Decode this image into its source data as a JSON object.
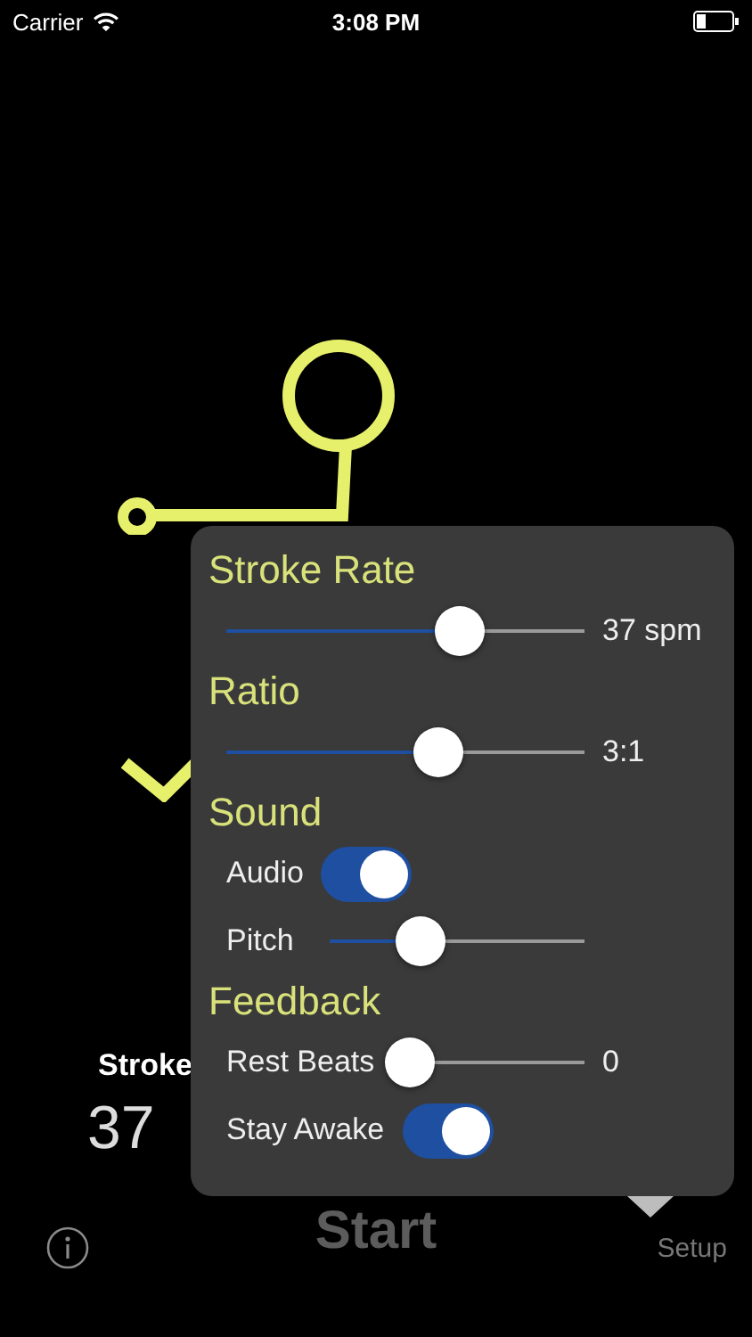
{
  "status_bar": {
    "carrier": "Carrier",
    "time": "3:08 PM"
  },
  "background": {
    "stat_label": "Stroke",
    "stat_value": "37"
  },
  "popover": {
    "sections": [
      {
        "title": "Stroke Rate",
        "rows": [
          {
            "kind": "slider",
            "level": 0.65,
            "value": "37 spm"
          }
        ]
      },
      {
        "title": "Ratio",
        "rows": [
          {
            "kind": "slider",
            "level": 0.59,
            "value": "3:1"
          }
        ]
      },
      {
        "title": "Sound",
        "rows": [
          {
            "kind": "toggle",
            "label": "Audio",
            "on": true
          },
          {
            "kind": "slider",
            "label": "Pitch",
            "level": 0.36
          }
        ]
      },
      {
        "title": "Feedback",
        "rows": [
          {
            "kind": "slider",
            "label": "Rest Beats",
            "level": 0,
            "value": "0"
          },
          {
            "kind": "toggle",
            "label": "Stay Awake",
            "on": true
          }
        ]
      }
    ]
  },
  "bottom_bar": {
    "start": "Start",
    "setup": "Setup"
  }
}
